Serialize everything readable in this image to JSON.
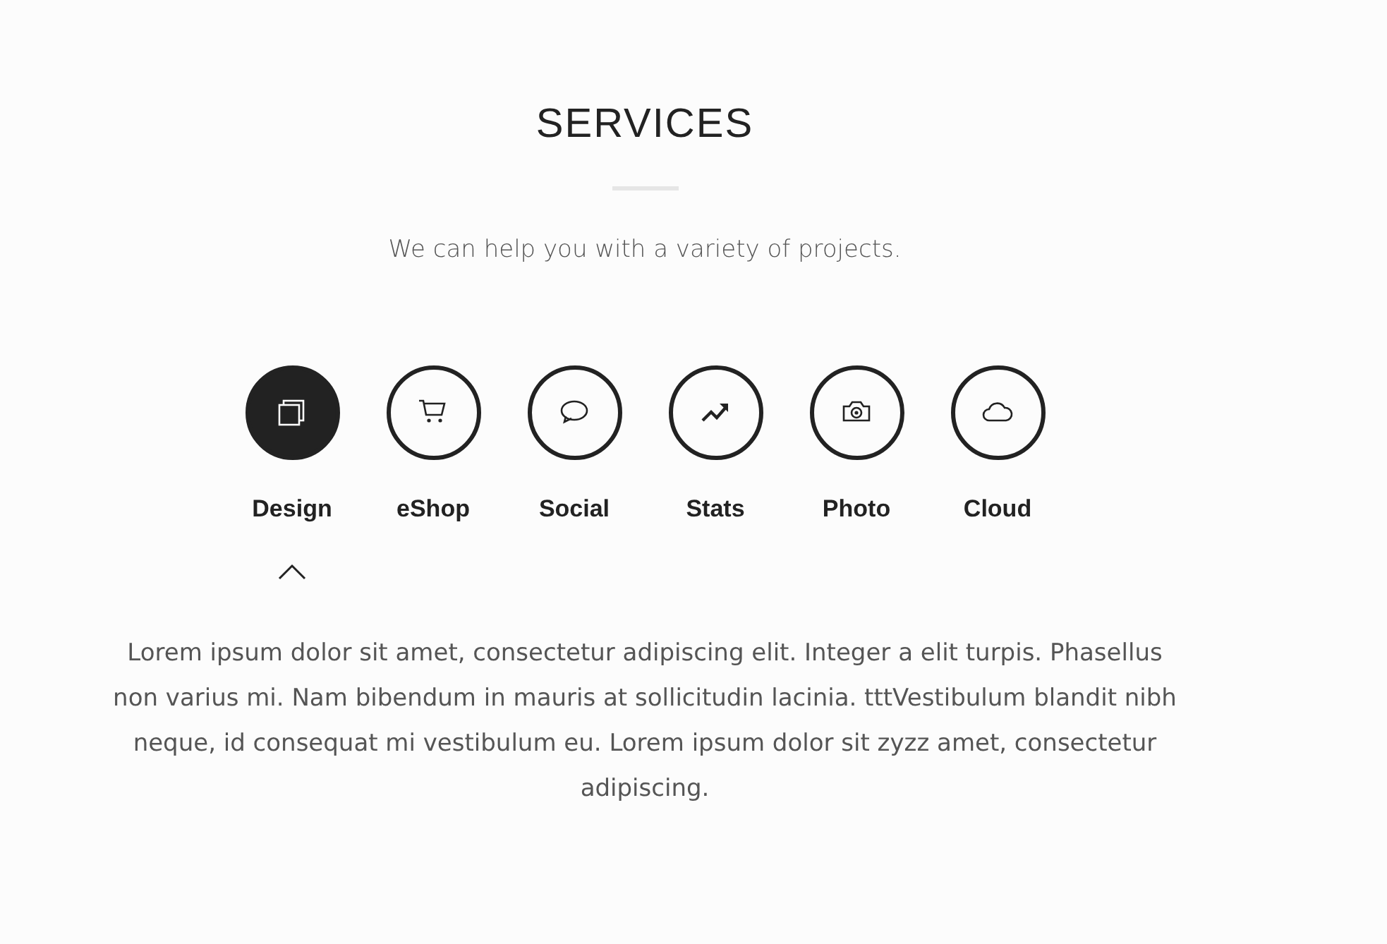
{
  "title": "SERVICES",
  "subtitle": "We can help you with a variety of projects.",
  "tabs": [
    {
      "label": "Design",
      "selected": true
    },
    {
      "label": "eShop",
      "selected": false
    },
    {
      "label": "Social",
      "selected": false
    },
    {
      "label": "Stats",
      "selected": false
    },
    {
      "label": "Photo",
      "selected": false
    },
    {
      "label": "Cloud",
      "selected": false
    }
  ],
  "description": "Lorem ipsum dolor sit amet, consectetur adipiscing elit. Integer a elit turpis. Phasellus non varius mi. Nam bibendum in mauris at sollicitudin lacinia. tttVestibulum blandit nibh neque, id consequat mi vestibulum eu. Lorem ipsum dolor sit zyzz amet, consectetur adipiscing."
}
